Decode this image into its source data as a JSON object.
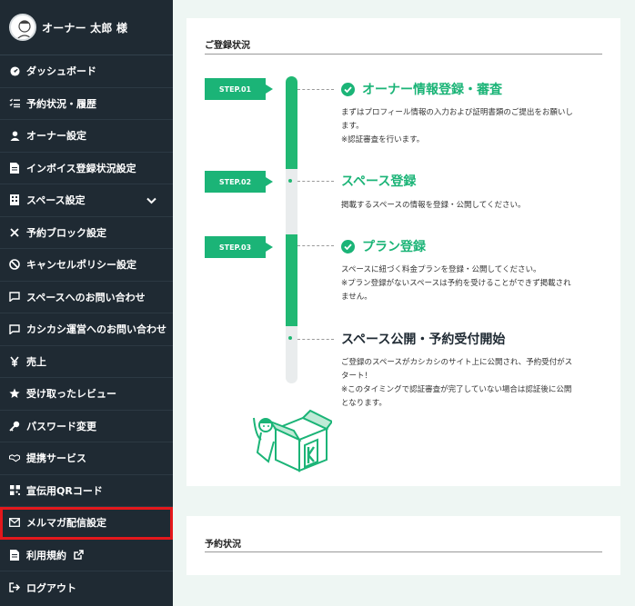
{
  "user": {
    "name": "オーナー 太郎 様"
  },
  "sidebar": {
    "items": [
      {
        "label": "ダッシュボード",
        "icon": "dashboard-icon"
      },
      {
        "label": "予約状況・履歴",
        "icon": "list-icon"
      },
      {
        "label": "オーナー設定",
        "icon": "user-icon"
      },
      {
        "label": "インボイス登録状況設定",
        "icon": "document-icon"
      },
      {
        "label": "スペース設定",
        "icon": "building-icon"
      },
      {
        "label": "予約ブロック設定",
        "icon": "close-icon"
      },
      {
        "label": "キャンセルポリシー設定",
        "icon": "ban-icon"
      },
      {
        "label": "スペースへのお問い合わせ",
        "icon": "chat-icon"
      },
      {
        "label": "カシカシ運営へのお問い合わせ",
        "icon": "chat-icon"
      },
      {
        "label": "売上",
        "icon": "yen-icon"
      },
      {
        "label": "受け取ったレビュー",
        "icon": "star-icon"
      },
      {
        "label": "パスワード変更",
        "icon": "key-icon"
      },
      {
        "label": "提携サービス",
        "icon": "handshake-icon"
      },
      {
        "label": "宣伝用QRコード",
        "icon": "qr-icon"
      },
      {
        "label": "メルマガ配信設定",
        "icon": "mail-icon"
      },
      {
        "label": "利用規約",
        "icon": "document-icon"
      },
      {
        "label": "ログアウト",
        "icon": "logout-icon"
      }
    ]
  },
  "registration": {
    "title": "ご登録状況",
    "steps": [
      {
        "tag": "STEP.01",
        "heading": "オーナー情報登録・審査",
        "lines": [
          "まずはプロフィール情報の入力および証明書類のご提出をお願いし",
          "ます。",
          "※認証審査を行います。"
        ]
      },
      {
        "tag": "STEP.02",
        "heading": "スペース登録",
        "lines": [
          "掲載するスペースの情報を登録・公開してください。"
        ]
      },
      {
        "tag": "STEP.03",
        "heading": "プラン登録",
        "lines": [
          "スペースに紐づく料金プランを登録・公開してください。",
          "※プラン登録がないスペースは予約を受けることができず掲載され",
          "ません。"
        ]
      },
      {
        "tag": "",
        "heading": "スペース公開・予約受付開始",
        "lines": [
          "ご登録のスペースがカシカシのサイト上に公開され、予約受付がス",
          "タート！",
          "※このタイミングで認証審査が完了していない場合は認証後に公開",
          "となります。"
        ]
      }
    ]
  },
  "reservation": {
    "title": "予約状況"
  },
  "colors": {
    "accent": "#1bb477",
    "sidebar": "#1f2a33",
    "highlight": "#e4181c"
  }
}
